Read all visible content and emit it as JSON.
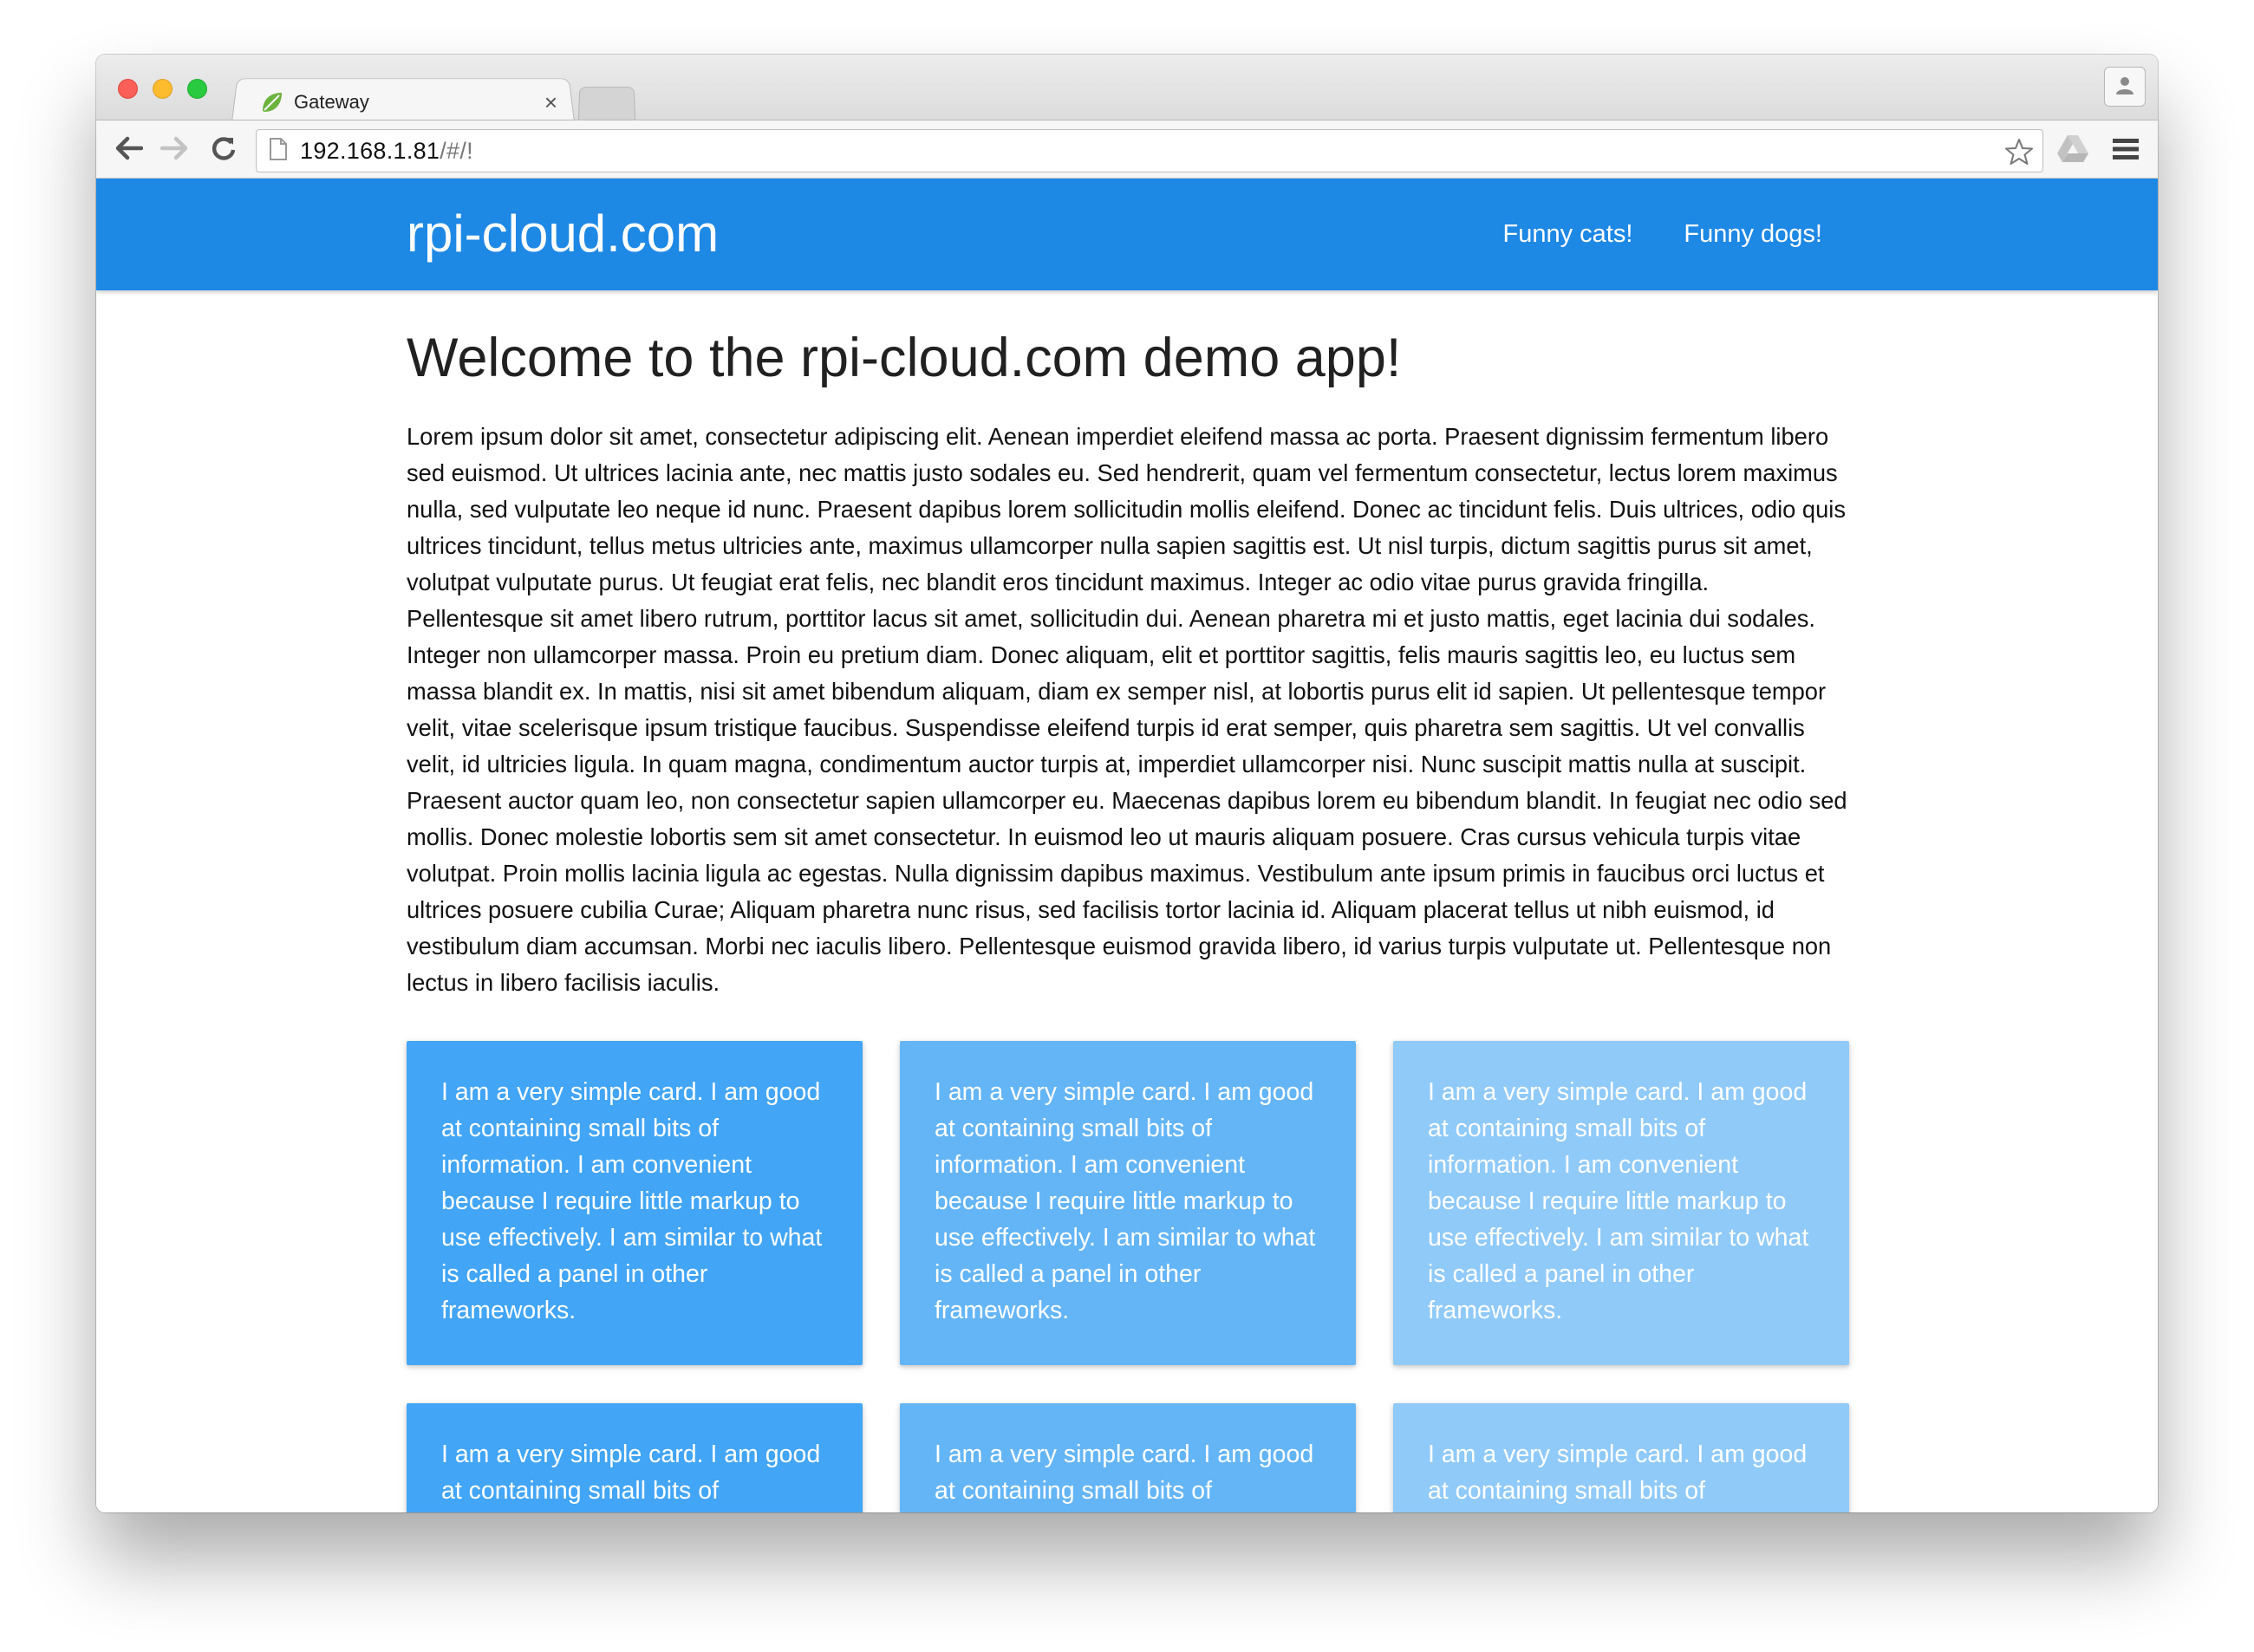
{
  "browser": {
    "tab_title": "Gateway",
    "tab_close": "×",
    "url_host": "192.168.1.81",
    "url_path": "/#/!"
  },
  "navbar": {
    "brand": "rpi-cloud.com",
    "links": [
      "Funny cats!",
      "Funny dogs!"
    ]
  },
  "main": {
    "heading": "Welcome to the rpi-cloud.com demo app!",
    "paragraph": "Lorem ipsum dolor sit amet, consectetur adipiscing elit. Aenean imperdiet eleifend massa ac porta. Praesent dignissim fermentum libero sed euismod. Ut ultrices lacinia ante, nec mattis justo sodales eu. Sed hendrerit, quam vel fermentum consectetur, lectus lorem maximus nulla, sed vulputate leo neque id nunc. Praesent dapibus lorem sollicitudin mollis eleifend. Donec ac tincidunt felis. Duis ultrices, odio quis ultrices tincidunt, tellus metus ultricies ante, maximus ullamcorper nulla sapien sagittis est. Ut nisl turpis, dictum sagittis purus sit amet, volutpat vulputate purus. Ut feugiat erat felis, nec blandit eros tincidunt maximus. Integer ac odio vitae purus gravida fringilla. Pellentesque sit amet libero rutrum, porttitor lacus sit amet, sollicitudin dui. Aenean pharetra mi et justo mattis, eget lacinia dui sodales. Integer non ullamcorper massa. Proin eu pretium diam. Donec aliquam, elit et porttitor sagittis, felis mauris sagittis leo, eu luctus sem massa blandit ex. In mattis, nisi sit amet bibendum aliquam, diam ex semper nisl, at lobortis purus elit id sapien. Ut pellentesque tempor velit, vitae scelerisque ipsum tristique faucibus. Suspendisse eleifend turpis id erat semper, quis pharetra sem sagittis. Ut vel convallis velit, id ultricies ligula. In quam magna, condimentum auctor turpis at, imperdiet ullamcorper nisi. Nunc suscipit mattis nulla at suscipit. Praesent auctor quam leo, non consectetur sapien ullamcorper eu. Maecenas dapibus lorem eu bibendum blandit. In feugiat nec odio sed mollis. Donec molestie lobortis sem sit amet consectetur. In euismod leo ut mauris aliquam posuere. Cras cursus vehicula turpis vitae volutpat. Proin mollis lacinia ligula ac egestas. Nulla dignissim dapibus maximus. Vestibulum ante ipsum primis in faucibus orci luctus et ultrices posuere cubilia Curae; Aliquam pharetra nunc risus, sed facilisis tortor lacinia id. Aliquam placerat tellus ut nibh euismod, id vestibulum diam accumsan. Morbi nec iaculis libero. Pellentesque euismod gravida libero, id varius turpis vulputate ut. Pellentesque non lectus in libero facilisis iaculis.",
    "cards": [
      "I am a very simple card. I am good at containing small bits of information. I am convenient because I require little markup to use effectively. I am similar to what is called a panel in other frameworks.",
      "I am a very simple card. I am good at containing small bits of information. I am convenient because I require little markup to use effectively. I am similar to what is called a panel in other frameworks.",
      "I am a very simple card. I am good at containing small bits of information. I am convenient because I require little markup to use effectively. I am similar to what is called a panel in other frameworks.",
      "I am a very simple card. I am good at containing small bits of information. I am convenient because I require little markup to use effectively. I am similar to what is called a panel in other frameworks.",
      "I am a very simple card. I am good at containing small bits of information. I am convenient because I require little markup to use effectively. I am similar to what is called a panel in other frameworks.",
      "I am a very simple card. I am good at containing small bits of information. I am convenient because I require little markup to use effectively. I am similar to what is called a panel in other frameworks."
    ]
  },
  "colors": {
    "appbar": "#1e88e5",
    "card_1": "#42a5f5",
    "card_2": "#64b5f6",
    "card_3": "#90caf9"
  },
  "icons": {
    "favicon": "spring-leaf-icon",
    "back": "back-arrow-icon",
    "forward": "forward-arrow-icon",
    "reload": "reload-icon",
    "page": "page-icon",
    "bookmark": "star-icon",
    "drive": "drive-icon",
    "menu": "hamburger-menu-icon",
    "profile": "person-icon"
  }
}
